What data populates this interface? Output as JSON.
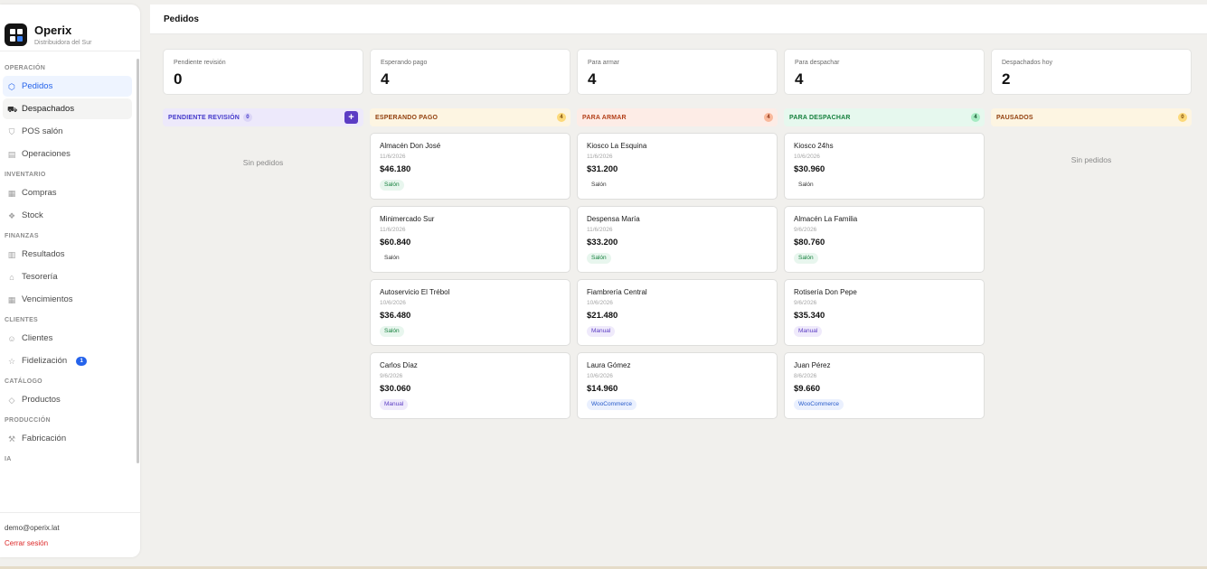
{
  "brand": {
    "name": "Operix",
    "subtitle": "Distribuidora del Sur"
  },
  "nav": {
    "sections": [
      {
        "title": "OPERACIÓN",
        "items": [
          {
            "label": "Pedidos",
            "icon": "box-icon",
            "state": "active"
          },
          {
            "label": "Despachados",
            "icon": "truck-icon",
            "state": "hover"
          },
          {
            "label": "POS salón",
            "icon": "cart-icon"
          },
          {
            "label": "Operaciones",
            "icon": "document-icon"
          }
        ]
      },
      {
        "title": "INVENTARIO",
        "items": [
          {
            "label": "Compras",
            "icon": "calendar-icon"
          },
          {
            "label": "Stock",
            "icon": "boxes-icon"
          }
        ]
      },
      {
        "title": "FINANZAS",
        "items": [
          {
            "label": "Resultados",
            "icon": "bar-chart-icon"
          },
          {
            "label": "Tesorería",
            "icon": "bank-icon"
          },
          {
            "label": "Vencimientos",
            "icon": "calendar-icon"
          }
        ]
      },
      {
        "title": "CLIENTES",
        "items": [
          {
            "label": "Clientes",
            "icon": "users-icon"
          },
          {
            "label": "Fidelización",
            "icon": "star-icon",
            "badge": "1"
          }
        ]
      },
      {
        "title": "CATÁLOGO",
        "items": [
          {
            "label": "Productos",
            "icon": "tag-icon"
          }
        ]
      },
      {
        "title": "PRODUCCIÓN",
        "items": [
          {
            "label": "Fabricación",
            "icon": "wrench-icon"
          }
        ]
      },
      {
        "title": "IA",
        "items": []
      }
    ]
  },
  "user": {
    "email": "demo@operix.lat",
    "logout": "Cerrar sesión"
  },
  "page": {
    "title": "Pedidos"
  },
  "stats": [
    {
      "label": "Pendiente revisión",
      "value": "0"
    },
    {
      "label": "Esperando pago",
      "value": "4"
    },
    {
      "label": "Para armar",
      "value": "4"
    },
    {
      "label": "Para despachar",
      "value": "4"
    },
    {
      "label": "Despachados hoy",
      "value": "2"
    }
  ],
  "columns": [
    {
      "title": "PENDIENTE REVISIÓN",
      "count": "0",
      "empty": "Sin pedidos",
      "head_bg": "#ede9fb",
      "head_color": "#4338ca",
      "count_bg": "#dcd6f7",
      "count_color": "#4338ca",
      "cards": []
    },
    {
      "title": "ESPERANDO PAGO",
      "count": "4",
      "head_bg": "#fdf5e2",
      "head_color": "#92400e",
      "count_bg": "#fcd97a",
      "count_color": "#7c4a03",
      "cards": [
        {
          "name": "Almacén Don José",
          "date": "11/6/2026",
          "total": "$46.180",
          "tag": "Salón",
          "tag_style": "salon-green"
        },
        {
          "name": "Minimercado Sur",
          "date": "11/6/2026",
          "total": "$60.840",
          "tag": "Salón",
          "tag_style": "salon-plain"
        },
        {
          "name": "Autoservicio El Trébol",
          "date": "10/6/2026",
          "total": "$36.480",
          "tag": "Salón",
          "tag_style": "salon-green"
        },
        {
          "name": "Carlos Díaz",
          "date": "9/6/2026",
          "total": "$30.060",
          "tag": "Manual",
          "tag_style": "manual"
        }
      ]
    },
    {
      "title": "PARA ARMAR",
      "count": "4",
      "head_bg": "#fdece6",
      "head_color": "#b3401a",
      "count_bg": "#f9b99c",
      "count_color": "#8a2e0f",
      "cards": [
        {
          "name": "Kiosco La Esquina",
          "date": "11/6/2026",
          "total": "$31.200",
          "tag": "Salón",
          "tag_style": "salon-plain"
        },
        {
          "name": "Despensa María",
          "date": "11/6/2026",
          "total": "$33.200",
          "tag": "Salón",
          "tag_style": "salon-green"
        },
        {
          "name": "Fiambrería Central",
          "date": "10/6/2026",
          "total": "$21.480",
          "tag": "Manual",
          "tag_style": "manual"
        },
        {
          "name": "Laura Gómez",
          "date": "10/6/2026",
          "total": "$14.960",
          "tag": "WooCommerce",
          "tag_style": "woo"
        }
      ]
    },
    {
      "title": "PARA DESPACHAR",
      "count": "4",
      "head_bg": "#e6f8ee",
      "head_color": "#15803d",
      "count_bg": "#a7ebc3",
      "count_color": "#14532d",
      "cards": [
        {
          "name": "Kiosco 24hs",
          "date": "10/6/2026",
          "total": "$30.960",
          "tag": "Salón",
          "tag_style": "salon-plain"
        },
        {
          "name": "Almacén La Familia",
          "date": "9/6/2026",
          "total": "$80.760",
          "tag": "Salón",
          "tag_style": "salon-green"
        },
        {
          "name": "Rotisería Don Pepe",
          "date": "9/6/2026",
          "total": "$35.340",
          "tag": "Manual",
          "tag_style": "manual"
        },
        {
          "name": "Juan Pérez",
          "date": "8/6/2026",
          "total": "$9.660",
          "tag": "WooCommerce",
          "tag_style": "woo"
        }
      ]
    },
    {
      "title": "PAUSADOS",
      "count": "0",
      "empty": "Sin pedidos",
      "head_bg": "#fdf5e2",
      "head_color": "#92400e",
      "count_bg": "#fcd97a",
      "count_color": "#7c4a03",
      "cards": []
    }
  ]
}
